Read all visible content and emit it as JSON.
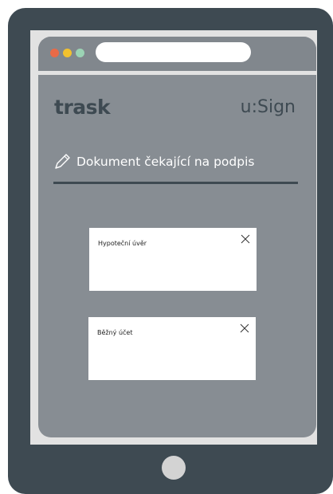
{
  "colors": {
    "device_frame": "#3e4a52",
    "screen_bg": "#878d93",
    "accent_dark": "#3e4a52",
    "window_dot_red": "#e96a47",
    "window_dot_yellow": "#f2c12e",
    "window_dot_green": "#9bd3b4"
  },
  "header": {
    "brand": "trask",
    "product": "u:Sign"
  },
  "section": {
    "icon": "pencil-icon",
    "title": "Dokument čekající na podpis"
  },
  "documents": [
    {
      "title": "Hypoteční úvěr",
      "close_icon": "close-icon"
    },
    {
      "title": "Běžný účet",
      "close_icon": "close-icon"
    }
  ]
}
